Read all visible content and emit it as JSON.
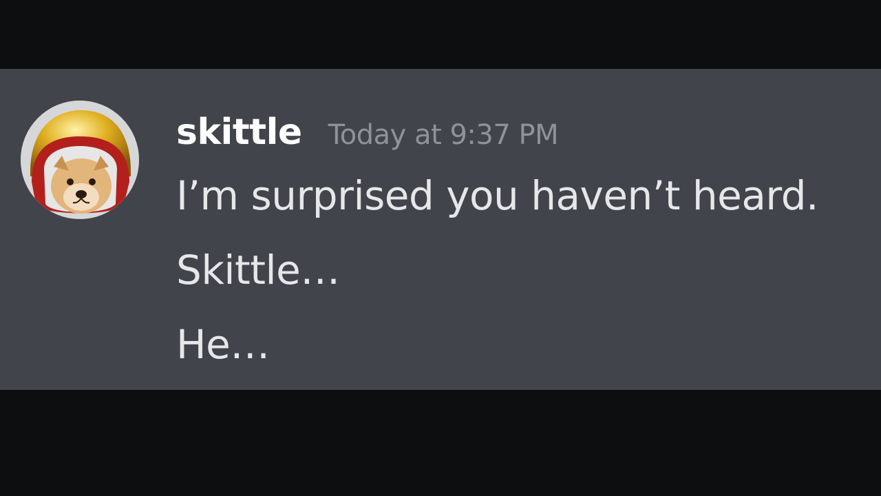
{
  "message": {
    "author": "skittle",
    "timestamp": "Today at 9:37 PM",
    "lines": [
      "I’m surprised you haven’t heard.",
      "Skittle…",
      "He…"
    ],
    "avatar_icon": "dog-in-helmet-avatar"
  },
  "colors": {
    "message_bg": "#41444b",
    "letterbox": "#0d0e10",
    "username": "#ffffff",
    "timestamp": "#8f9297",
    "text": "#e6e7e9"
  }
}
